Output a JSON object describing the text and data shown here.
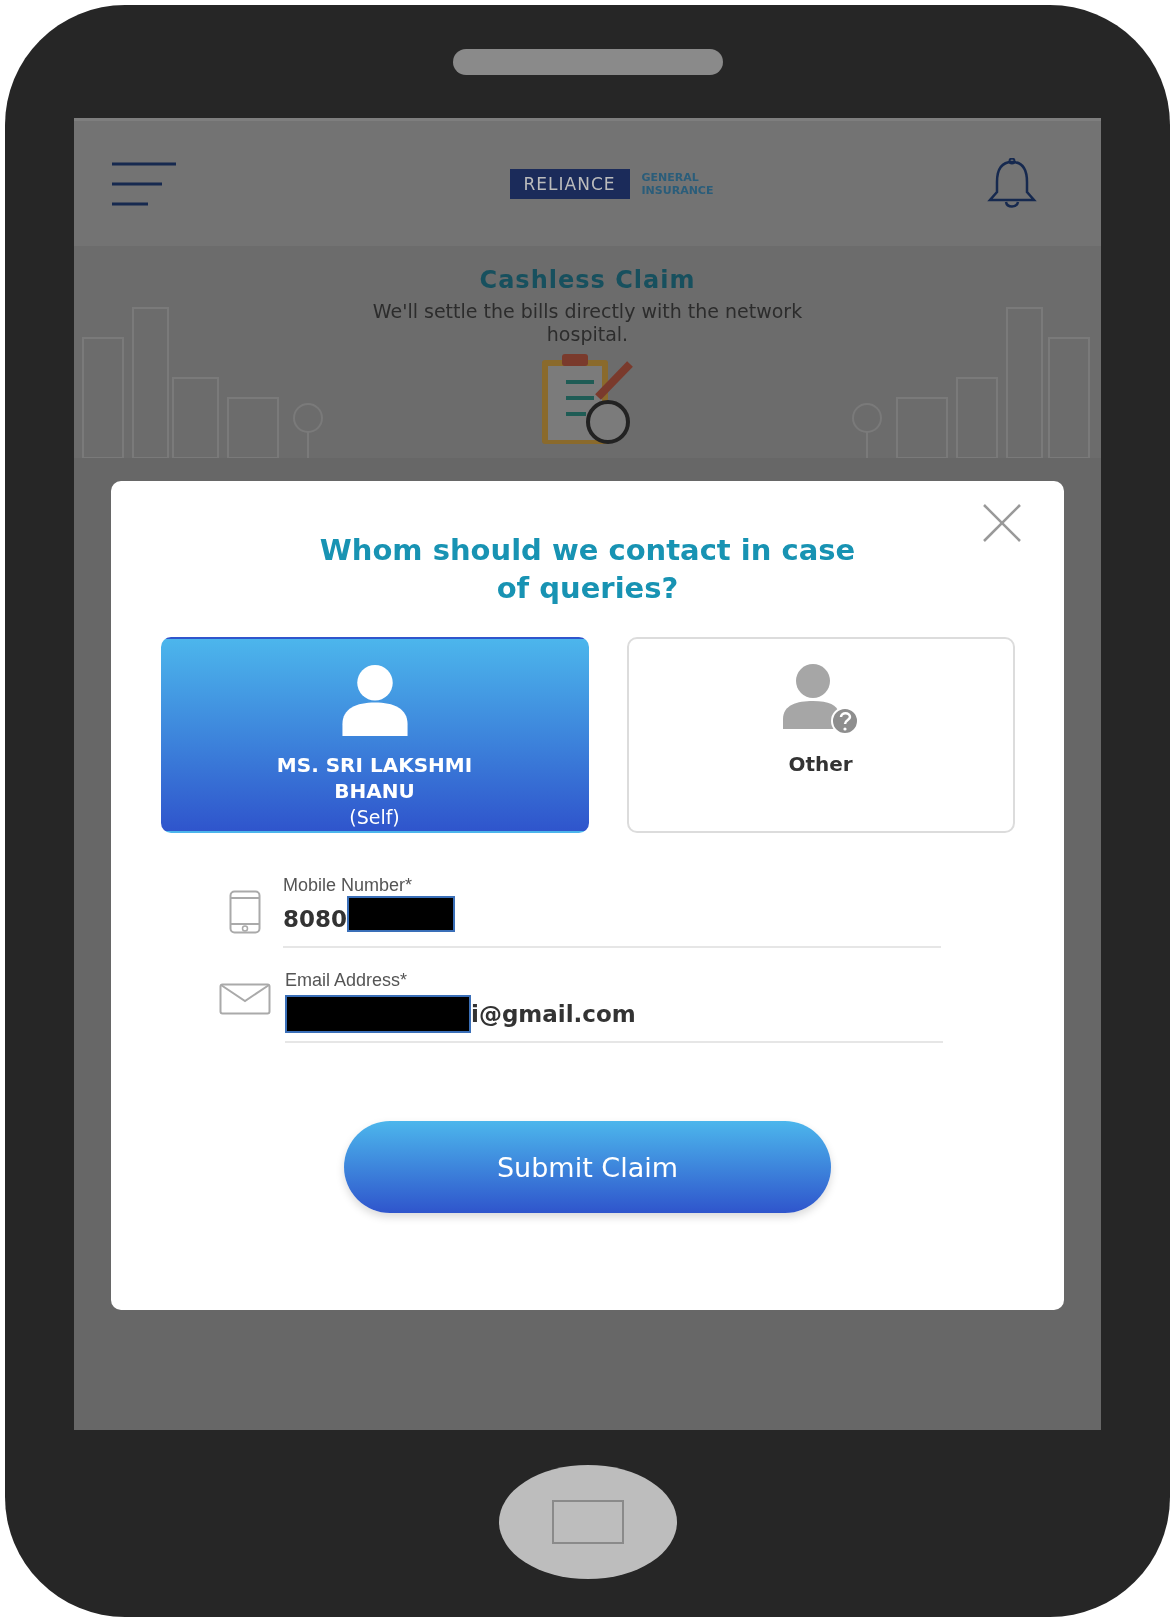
{
  "header": {
    "brand": "RELIANCE",
    "tagline": [
      "GENERAL",
      "INSURANCE"
    ]
  },
  "banner": {
    "title": "Cashless Claim",
    "subtitle": "We'll settle the bills directly with the network hospital."
  },
  "dialog": {
    "title": "Whom should we contact in case of queries?",
    "options": [
      {
        "kind": "self",
        "name": "MS. SRI LAKSHMI BHANU",
        "relation": "(Self)",
        "selected": true
      },
      {
        "kind": "other",
        "name": "Other",
        "selected": false
      }
    ],
    "fields": [
      {
        "kind": "phone",
        "label": "Mobile Number*",
        "value": "8080",
        "redacted_before": false,
        "redacted_after": true
      },
      {
        "kind": "email",
        "label": "Email Address*",
        "value": "i@gmail.com",
        "redacted_before": true,
        "redacted_after": false
      }
    ],
    "submit": "Submit Claim"
  }
}
